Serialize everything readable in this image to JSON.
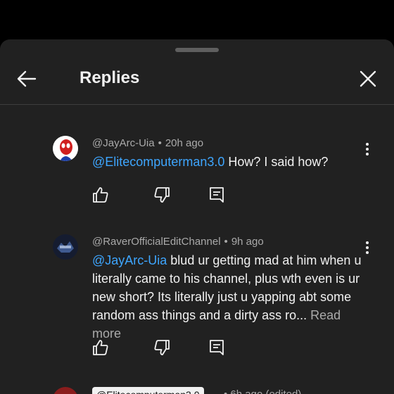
{
  "header": {
    "title": "Replies",
    "back_icon": "arrow-left-icon",
    "close_icon": "close-icon"
  },
  "comments": [
    {
      "author": "@JayArc-Uia",
      "time": "20h ago",
      "mention": "@Elitecomputerman3.0",
      "text": " How? I said how?",
      "read_more": ""
    },
    {
      "author": "@RaverOfficialEditChannel",
      "time": "9h ago",
      "mention": "@JayArc-Uia",
      "text": " blud ur getting mad at him when u literally came to his channel, plus wth even is ur new short? Its literally just u yapping abt some random ass things and a dirty ass ro...",
      "read_more": " Read more"
    }
  ],
  "partial_comment": {
    "author": "@Elitecomputerman3.0",
    "meta": "• 6h ago (edited)"
  },
  "colors": {
    "background": "#212121",
    "mention": "#3ea6ff",
    "secondary_text": "#aaaaaa"
  }
}
